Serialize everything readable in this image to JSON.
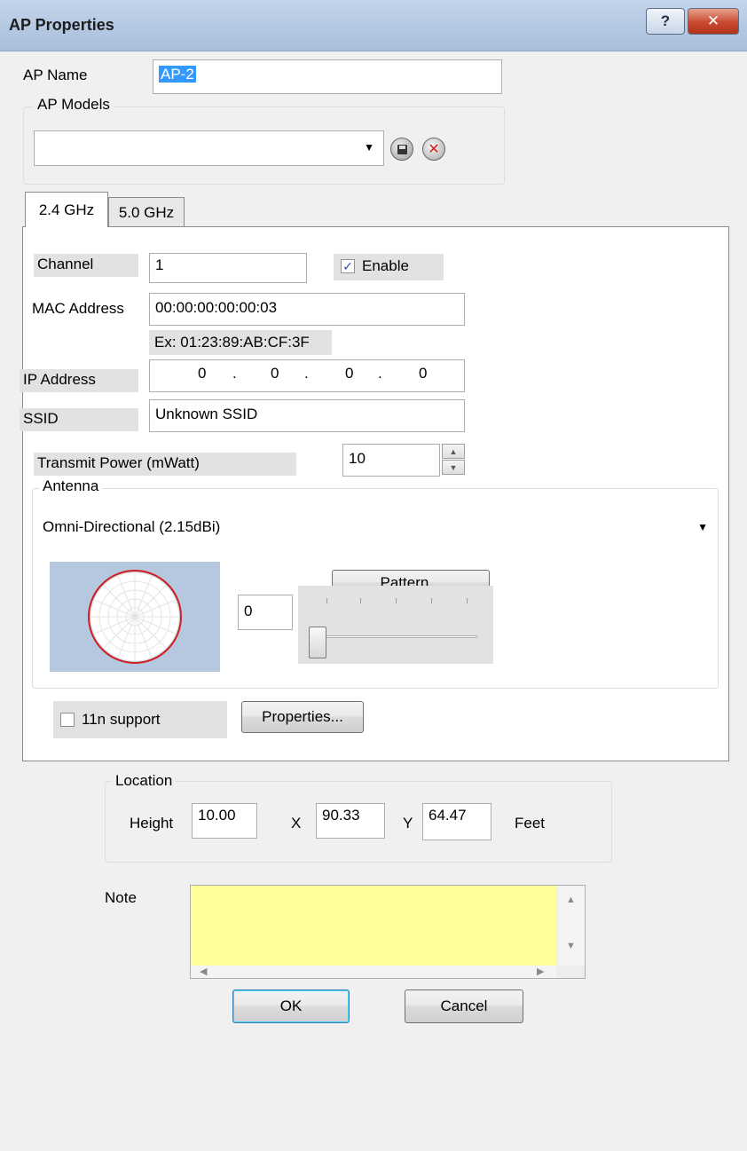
{
  "window": {
    "title": "AP Properties",
    "help_label": "?",
    "close_label": "✕"
  },
  "ap_name": {
    "label": "AP Name",
    "value": "AP-2"
  },
  "ap_models": {
    "legend": "AP Models",
    "value": "",
    "save_icon": "save-icon",
    "delete_icon": "delete-icon"
  },
  "tabs": [
    {
      "label": "2.4 GHz",
      "selected": true
    },
    {
      "label": "5.0 GHz",
      "selected": false
    }
  ],
  "radio": {
    "channel_label": "Channel",
    "channel_value": "1",
    "enable_label": "Enable",
    "enable_checked": true,
    "mac_label": "MAC Address",
    "mac_value": "00:00:00:00:00:03",
    "mac_example": "Ex: 01:23:89:AB:CF:3F",
    "ip_label": "IP Address",
    "ip_octets": [
      "0",
      ".",
      "0",
      ".",
      "0",
      ".",
      "0"
    ],
    "ssid_label": "SSID",
    "ssid_value": "Unknown SSID",
    "power_label": "Transmit Power (mWatt)",
    "power_value": "10"
  },
  "antenna": {
    "legend": "Antenna",
    "selected": "Omni-Directional (2.15dBi)",
    "pattern_button": "Pattern...",
    "rotation_value": "0"
  },
  "n_support": {
    "label": "11n support",
    "checked": false,
    "properties_button": "Properties..."
  },
  "location": {
    "legend": "Location",
    "height_label": "Height",
    "height_value": "10.00",
    "x_label": "X",
    "x_value": "90.33",
    "y_label": "Y",
    "y_value": "64.47",
    "unit": "Feet"
  },
  "note": {
    "label": "Note",
    "value": ""
  },
  "buttons": {
    "ok": "OK",
    "cancel": "Cancel"
  },
  "colors": {
    "note_bg": "#ffff99",
    "antenna_preview_bg": "#b5c8e0",
    "pattern_outline": "#d02020",
    "selection": "#3399ff"
  }
}
